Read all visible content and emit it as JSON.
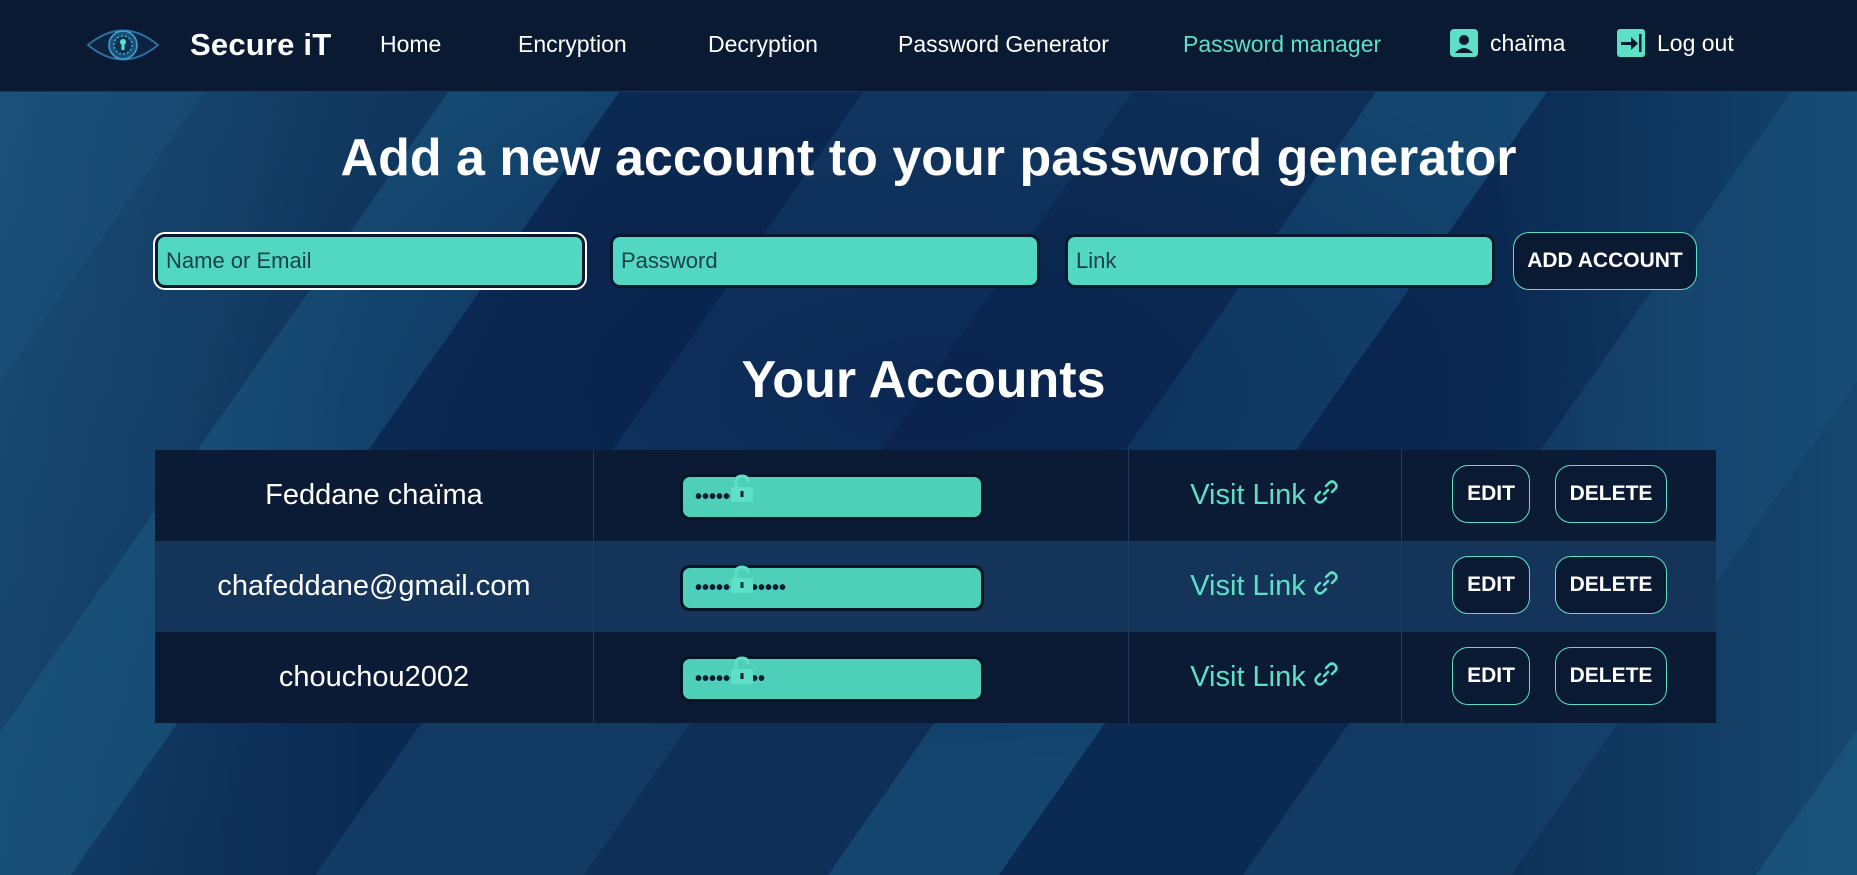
{
  "nav": {
    "brand": "Secure iT",
    "links": [
      {
        "label": "Home"
      },
      {
        "label": "Encryption"
      },
      {
        "label": "Decryption"
      },
      {
        "label": "Password Generator"
      },
      {
        "label": "Password manager",
        "active": true
      }
    ],
    "user": "chaïma",
    "logout": "Log out"
  },
  "form": {
    "title": "Add a new account to your password generator",
    "name_placeholder": "Name or Email",
    "password_placeholder": "Password",
    "link_placeholder": "Link",
    "add_label": "ADD ACCOUNT"
  },
  "accounts": {
    "title": "Your Accounts",
    "rows": [
      {
        "name": "Feddane chaïma",
        "password_masked": "••••••••",
        "link_label": "Visit Link",
        "edit_label": "EDIT",
        "delete_label": "DELETE"
      },
      {
        "name": "chafeddane@gmail.com",
        "password_masked": "•••••••••••••",
        "link_label": "Visit Link",
        "edit_label": "EDIT",
        "delete_label": "DELETE"
      },
      {
        "name": "chouchou2002",
        "password_masked": "••••••••••",
        "link_label": "Visit Link",
        "edit_label": "EDIT",
        "delete_label": "DELETE"
      }
    ]
  },
  "colors": {
    "accent": "#5ee0c6",
    "nav_bg": "#0a1a33",
    "input_bg": "#52d7c2",
    "row_dark": "#0b1a35",
    "row_light": "#143459"
  }
}
